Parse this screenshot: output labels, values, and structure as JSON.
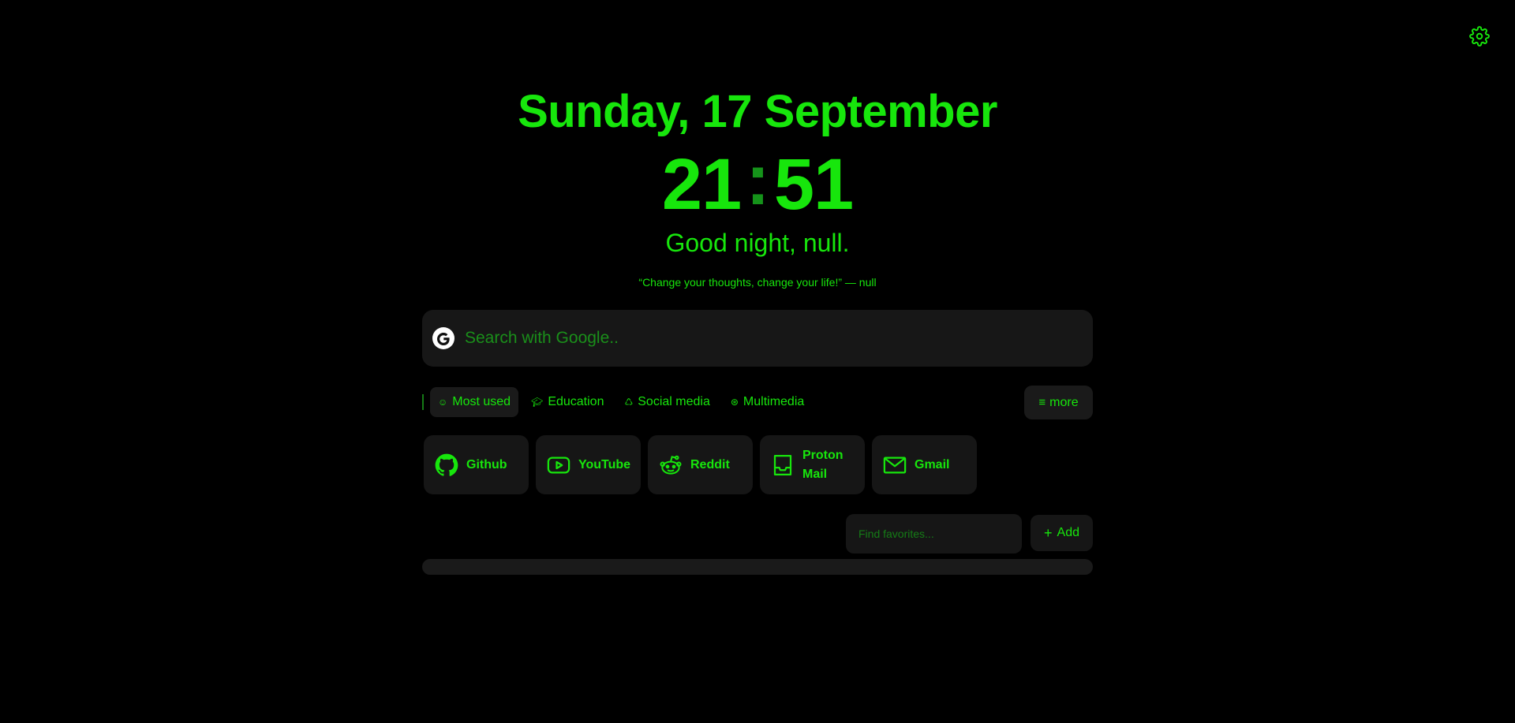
{
  "header": {
    "date": "Sunday, 17 September",
    "clock_hours": "21",
    "clock_sep": ":",
    "clock_minutes": "51",
    "greeting": "Good night, null.",
    "quote": "“Change your thoughts, change your life!” — null"
  },
  "search": {
    "placeholder": "Search with Google.."
  },
  "tabs": [
    {
      "icon": "☺",
      "label": "Most used",
      "active": true
    },
    {
      "icon": "🎓︎",
      "label": "Education",
      "active": false
    },
    {
      "icon": "♺",
      "label": "Social media",
      "active": false
    },
    {
      "icon": "⊛",
      "label": "Multimedia",
      "active": false
    }
  ],
  "more": {
    "icon": "≡",
    "label": "more"
  },
  "favorites": [
    {
      "label": "Github",
      "icon": "github-icon"
    },
    {
      "label": "YouTube",
      "icon": "youtube-icon"
    },
    {
      "label": "Reddit",
      "icon": "reddit-icon"
    },
    {
      "label": "Proton Mail",
      "icon": "inbox-icon"
    },
    {
      "label": "Gmail",
      "icon": "mail-icon"
    }
  ],
  "find": {
    "placeholder": "Find favorites..."
  },
  "add": {
    "icon": "+",
    "label": "Add"
  },
  "colors": {
    "accent": "#17e60c",
    "background": "#000000",
    "surface": "#171717"
  }
}
